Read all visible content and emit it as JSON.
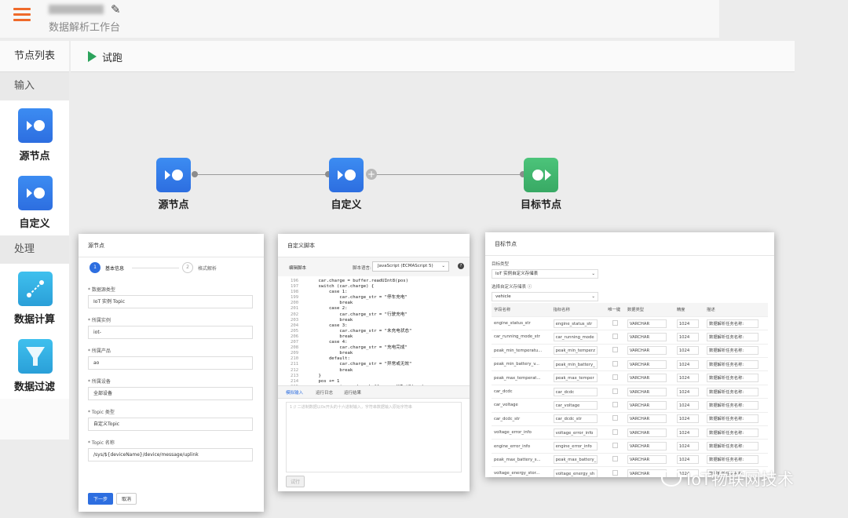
{
  "header": {
    "workspace_subtitle": "数据解析工作台"
  },
  "sidebar": {
    "title": "节点列表",
    "section_input": "输入",
    "section_process": "处理",
    "items": [
      {
        "label": "源节点",
        "icon": "source-node-icon"
      },
      {
        "label": "自定义",
        "icon": "custom-node-icon"
      },
      {
        "label": "数据计算",
        "icon": "compute-icon"
      },
      {
        "label": "数据过滤",
        "icon": "filter-icon"
      }
    ]
  },
  "toolbar": {
    "run_label": "试跑"
  },
  "flow": {
    "nodes": [
      {
        "label": "源节点"
      },
      {
        "label": "自定义"
      },
      {
        "label": "目标节点"
      }
    ]
  },
  "source_panel": {
    "title": "源节点",
    "step1": "1",
    "step1_label": "基本信息",
    "step2": "2",
    "step2_label": "格式解析",
    "fields": [
      {
        "label": "* 数据源类型",
        "value": "IoT 实例 Topic"
      },
      {
        "label": "* 所属实例",
        "value": "iot-"
      },
      {
        "label": "* 所属产品",
        "value": "ao"
      },
      {
        "label": "* 所属设备",
        "value": "全部设备"
      },
      {
        "label": "* Topic 类型",
        "value": "自定义Topic"
      },
      {
        "label": "* Topic 名称",
        "value": "/sys/${deviceName}/device/message/uplink"
      }
    ],
    "next_button": "下一步",
    "cancel_button": "取消"
  },
  "script_panel": {
    "title": "自定义脚本",
    "edit_label": "编辑脚本",
    "lang_label": "脚本语言:",
    "lang_value": "JavaScript (ECMAScript 5)",
    "code_lines": [
      {
        "n": "196",
        "t": "    car.charge = buffer.readUInt8(pos)"
      },
      {
        "n": "197",
        "t": "    switch (car.charge) {"
      },
      {
        "n": "198",
        "t": "        case 1:"
      },
      {
        "n": "199",
        "t": "            car.charge_str = \"停车充电\""
      },
      {
        "n": "200",
        "t": "            break"
      },
      {
        "n": "201",
        "t": "        case 2:"
      },
      {
        "n": "202",
        "t": "            car.charge_str = \"行驶充电\""
      },
      {
        "n": "203",
        "t": "            break"
      },
      {
        "n": "204",
        "t": "        case 3:"
      },
      {
        "n": "205",
        "t": "            car.charge_str = \"未充电状态\""
      },
      {
        "n": "206",
        "t": "            break"
      },
      {
        "n": "207",
        "t": "        case 4:"
      },
      {
        "n": "208",
        "t": "            car.charge_str = \"充电完成\""
      },
      {
        "n": "209",
        "t": "            break"
      },
      {
        "n": "210",
        "t": "        default:"
      },
      {
        "n": "211",
        "t": "            car.charge_str = \"异常或无效\""
      },
      {
        "n": "212",
        "t": "            break"
      },
      {
        "n": "213",
        "t": "    }"
      },
      {
        "n": "214",
        "t": "    pos += 1"
      },
      {
        "n": "215",
        "t": "    car.running_mode = buffer.readUInt8(pos)"
      }
    ],
    "tabs": [
      "模拟输入",
      "运行日志",
      "运行结果"
    ],
    "input_placeholder": "1 // 二进制数据以0x开头的十六进制输入，字符串数据输入原始字符串",
    "run_button": "试行"
  },
  "target_panel": {
    "title": "目标节点",
    "type_label": "目标类型",
    "type_value": "IoT 实例自定义存储表",
    "table_label": "选择自定义存储表",
    "table_value": "vehicle",
    "columns": [
      "字段名称",
      "指标名称",
      "唯一键",
      "数据类型",
      "精度",
      "描述"
    ],
    "rows": [
      [
        "engine_status_str",
        "engine_status_str",
        "VARCHAR",
        "1024",
        "数据解析任务名称:"
      ],
      [
        "car_running_mode_str",
        "car_running_mode",
        "VARCHAR",
        "1024",
        "数据解析任务名称:"
      ],
      [
        "peak_min_temperatu...",
        "peak_min_temperz",
        "VARCHAR",
        "1024",
        "数据解析任务名称:"
      ],
      [
        "peak_min_battery_v...",
        "peak_min_battery_",
        "VARCHAR",
        "1024",
        "数据解析任务名称:"
      ],
      [
        "peak_max_temperat...",
        "peak_max_temper",
        "VARCHAR",
        "1024",
        "数据解析任务名称:"
      ],
      [
        "car_dcdc",
        "car_dcdc",
        "VARCHAR",
        "1024",
        "数据解析任务名称:"
      ],
      [
        "car_voltage",
        "car_voltage",
        "VARCHAR",
        "1024",
        "数据解析任务名称:"
      ],
      [
        "car_dcdc_str",
        "car_dcdc_str",
        "VARCHAR",
        "1024",
        "数据解析任务名称:"
      ],
      [
        "voltage_error_info",
        "voltage_error_info",
        "VARCHAR",
        "1024",
        "数据解析任务名称:"
      ],
      [
        "engine_error_info",
        "engine_error_info",
        "VARCHAR",
        "1024",
        "数据解析任务名称:"
      ],
      [
        "peak_max_battery_s...",
        "peak_max_battery_",
        "VARCHAR",
        "1024",
        "数据解析任务名称:"
      ],
      [
        "voltage_energy_stor...",
        "voltage_energy_sh",
        "VARCHAR",
        "1024",
        "数据解析任务名称:"
      ]
    ]
  },
  "watermark": "IoT物联网技术",
  "colors": {
    "accent": "#ef6a2a",
    "node_blue": "#3c8cf2",
    "node_green": "#4cc47a",
    "run_green": "#2ca35c"
  }
}
